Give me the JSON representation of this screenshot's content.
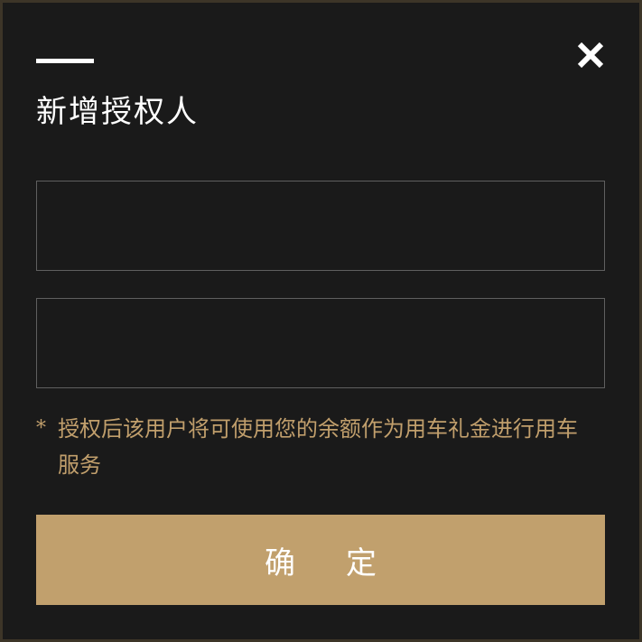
{
  "dialog": {
    "title": "新增授权人",
    "close_icon": "close-icon",
    "fields": [
      {
        "value": "",
        "placeholder": ""
      },
      {
        "value": "",
        "placeholder": ""
      }
    ],
    "note": {
      "marker": "*",
      "text": "授权后该用户将可使用您的余额作为用车礼金进行用车服务"
    },
    "confirm_label": "确定"
  },
  "colors": {
    "background": "#1a1a1a",
    "accent": "#c1a06d",
    "note_text": "#c19f6c",
    "field_border": "#5f5f5f",
    "frame_border": "#3d3528"
  }
}
